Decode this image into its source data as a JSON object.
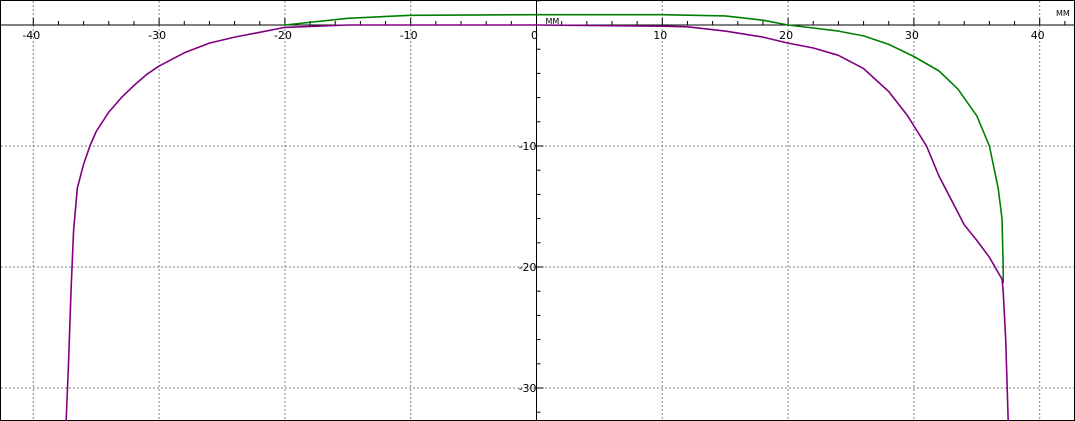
{
  "chart_data": {
    "type": "line",
    "x_unit": "MM",
    "x_unit_near_axis": "MM",
    "xlim": [
      -40.5,
      42.5
    ],
    "ylim": [
      -32.5,
      2.3
    ],
    "grid": true,
    "x_ticks": [
      -40,
      -30,
      -20,
      -10,
      0,
      10,
      20,
      30,
      40
    ],
    "x_tick_labels": [
      "-40",
      "-30",
      "-20",
      "-10",
      "0",
      "10",
      "20",
      "30",
      "40"
    ],
    "y_ticks": [
      -10,
      -20,
      -30
    ],
    "y_tick_labels": [
      "-10",
      "-20",
      "-30"
    ],
    "colors": {
      "green": "#008000",
      "purple": "#800080",
      "grid": "#808080",
      "axis": "#000000"
    },
    "series": [
      {
        "color": "#008000",
        "points": [
          [
            -20,
            0
          ],
          [
            -15,
            0.55
          ],
          [
            -10,
            0.8
          ],
          [
            0,
            0.85
          ],
          [
            10,
            0.85
          ],
          [
            15,
            0.75
          ],
          [
            18,
            0.4
          ],
          [
            20,
            0
          ],
          [
            22,
            -0.25
          ],
          [
            24,
            -0.5
          ],
          [
            26,
            -0.9
          ],
          [
            28,
            -1.6
          ],
          [
            30,
            -2.6
          ],
          [
            32,
            -3.8
          ],
          [
            33.5,
            -5.3
          ],
          [
            35,
            -7.5
          ],
          [
            36,
            -10
          ],
          [
            36.7,
            -13.5
          ],
          [
            37,
            -16
          ],
          [
            37.1,
            -20
          ],
          [
            37.1,
            -21.3
          ]
        ]
      },
      {
        "color": "#800080",
        "points": [
          [
            -37.4,
            -33
          ],
          [
            -37.2,
            -28
          ],
          [
            -37.0,
            -22
          ],
          [
            -36.8,
            -17
          ],
          [
            -36.5,
            -13.5
          ],
          [
            -36.0,
            -11.5
          ],
          [
            -35.5,
            -10
          ],
          [
            -35,
            -8.8
          ],
          [
            -34,
            -7.2
          ],
          [
            -33,
            -6
          ],
          [
            -32,
            -5
          ],
          [
            -31,
            -4.1
          ],
          [
            -30,
            -3.4
          ],
          [
            -28,
            -2.3
          ],
          [
            -26,
            -1.5
          ],
          [
            -24,
            -1
          ],
          [
            -22,
            -0.6
          ],
          [
            -20,
            -0.2
          ],
          [
            -15,
            0
          ],
          [
            0,
            0
          ],
          [
            10,
            -0.1
          ],
          [
            12,
            -0.15
          ],
          [
            15,
            -0.5
          ],
          [
            18,
            -1
          ],
          [
            20,
            -1.5
          ],
          [
            22,
            -1.9
          ],
          [
            24,
            -2.5
          ],
          [
            26,
            -3.6
          ],
          [
            28,
            -5.5
          ],
          [
            29.5,
            -7.5
          ],
          [
            31,
            -10
          ],
          [
            32,
            -12.5
          ],
          [
            33,
            -14.5
          ],
          [
            34,
            -16.5
          ],
          [
            35,
            -17.8
          ],
          [
            36,
            -19.2
          ],
          [
            37,
            -21
          ],
          [
            37.1,
            -22
          ],
          [
            37.3,
            -26
          ],
          [
            37.5,
            -33
          ]
        ]
      }
    ]
  }
}
